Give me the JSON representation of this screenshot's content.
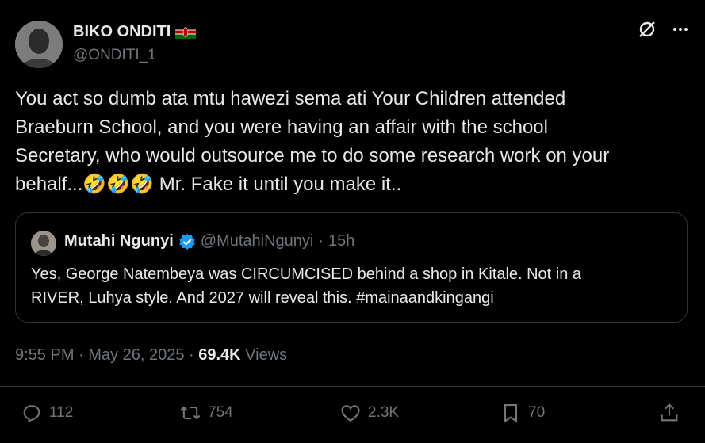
{
  "author": {
    "name": "BIKO ONDITI",
    "handle": "@ONDITI_1",
    "flag_icon": "kenya-flag-icon"
  },
  "tweet": {
    "line1": "You act so dumb ata mtu hawezi sema ati Your Children attended",
    "line2": "Braeburn School, and you were having an affair with the school",
    "line3": "Secretary, who would outsource me to do some research work on your",
    "line4_a": "behalf...",
    "emoji": "🤣🤣🤣",
    "line4_b": " Mr. Fake it until you make it.."
  },
  "quoted": {
    "name": "Mutahi Ngunyi",
    "handle": "@MutahiNgunyi",
    "separator": "·",
    "time": "15h",
    "line1": "Yes, George Natembeya was CIRCUMCISED behind a shop in Kitale. Not in a",
    "line2": "RIVER, Luhya style. And 2027 will reveal this. #mainaandkingangi"
  },
  "meta": {
    "time": "9:55 PM",
    "sep1": " · ",
    "date": "May 26, 2025",
    "sep2": " · ",
    "views_count": "69.4K",
    "views_label": " Views"
  },
  "actions": {
    "replies": "112",
    "retweets": "754",
    "likes": "2.3K",
    "bookmarks": "70"
  },
  "colors": {
    "background": "#000000",
    "text": "#e7e9ea",
    "muted": "#71767b",
    "verified": "#1d9bf0",
    "border": "#2f3336"
  }
}
